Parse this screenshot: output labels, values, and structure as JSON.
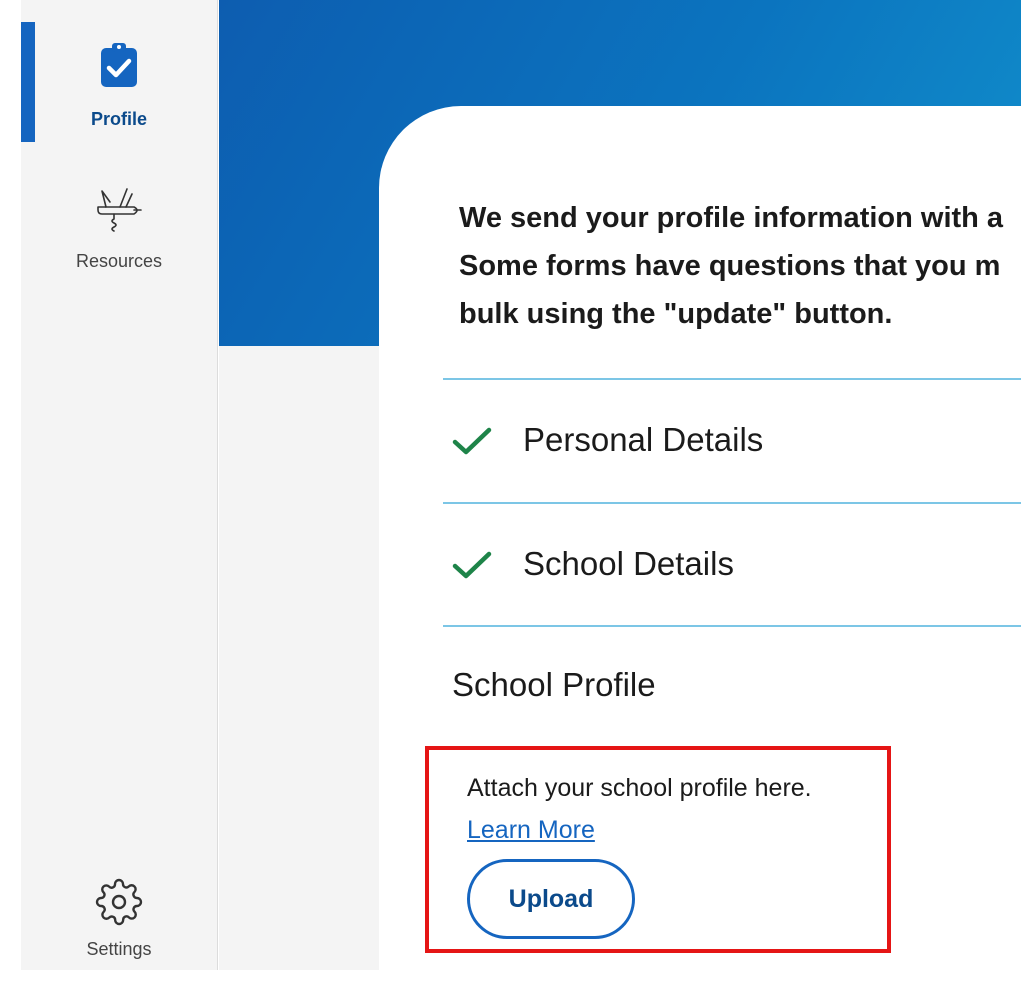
{
  "sidebar": {
    "items": [
      {
        "label": "Profile",
        "icon": "clipboard-check-icon",
        "active": true
      },
      {
        "label": "Resources",
        "icon": "multitool-icon",
        "active": false
      },
      {
        "label": "Settings",
        "icon": "gear-icon",
        "active": false
      }
    ]
  },
  "main": {
    "intro_lines": [
      "We send your profile information with a",
      "Some forms have questions that you m",
      "bulk using the \"update\" button."
    ],
    "sections": [
      {
        "label": "Personal Details",
        "status": "complete",
        "icon": "checkmark-icon"
      },
      {
        "label": "School Details",
        "status": "complete",
        "icon": "checkmark-icon"
      }
    ],
    "school_profile": {
      "title": "School Profile",
      "description": "Attach your school profile here.",
      "link_label": "Learn More",
      "button_label": "Upload"
    }
  },
  "colors": {
    "brand": "#1565c0",
    "check": "#1e8449",
    "highlight": "#e51515",
    "divider": "#7cc6e6"
  }
}
